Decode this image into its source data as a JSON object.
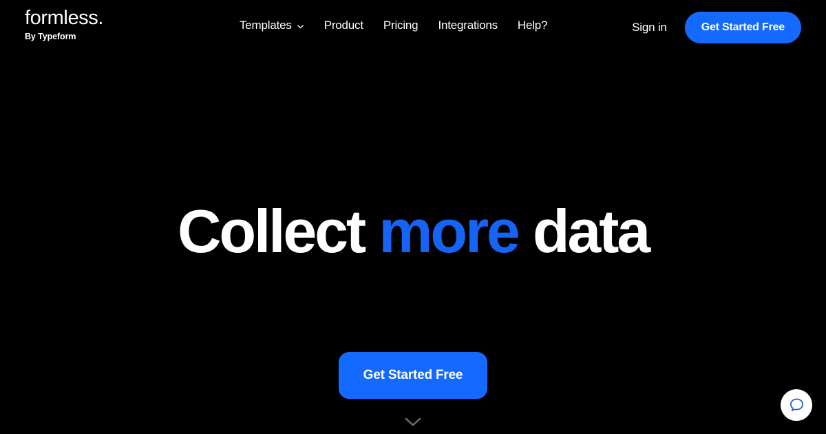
{
  "page": {
    "background_color": "#000000",
    "accent_color": "#1469FF",
    "headline_accent_color": "#1564F5",
    "text_color": "#FFFFFF"
  },
  "header": {
    "brand": {
      "name": "formless.",
      "subtitle": "By Typeform"
    },
    "nav": [
      {
        "label": "Templates",
        "has_dropdown": true,
        "icon": "chevron-down-icon"
      },
      {
        "label": "Product",
        "has_dropdown": false
      },
      {
        "label": "Pricing",
        "has_dropdown": false
      },
      {
        "label": "Integrations",
        "has_dropdown": false
      },
      {
        "label": "Help?",
        "has_dropdown": false
      }
    ],
    "sign_in_label": "Sign in",
    "cta_label": "Get Started Free"
  },
  "hero": {
    "headline_part1": "Collect ",
    "headline_accent": "more",
    "headline_part2": " data",
    "cta_label": "Get Started Free",
    "scroll_icon": "chevron-down-icon"
  },
  "chat": {
    "icon": "chat-bubble-icon"
  }
}
